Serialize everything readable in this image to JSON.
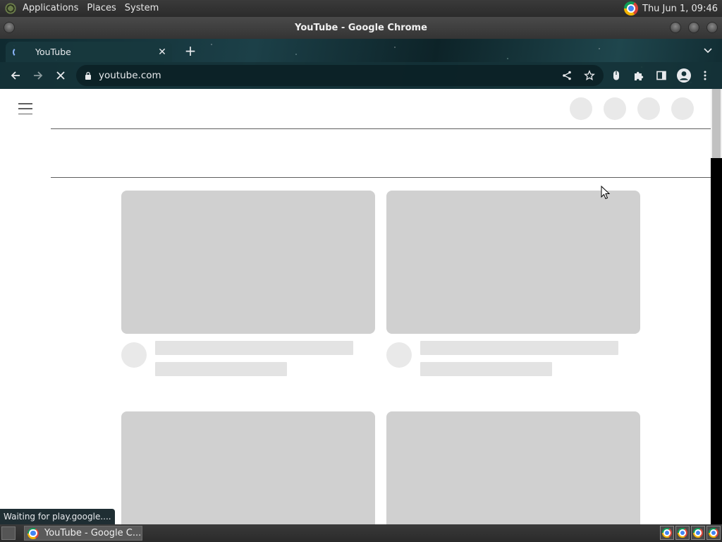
{
  "top_panel": {
    "menu": [
      "Applications",
      "Places",
      "System"
    ],
    "clock": "Thu Jun  1, 09:46"
  },
  "window": {
    "title": "YouTube - Google Chrome"
  },
  "browser": {
    "tab": {
      "title": "YouTube",
      "close_glyph": "✕"
    },
    "new_tab_glyph": "+",
    "url": "youtube.com",
    "status_text": "Waiting for play.google...."
  },
  "taskbar": {
    "task_label": "YouTube - Google C..."
  },
  "icons": {
    "back": "arrow-left-icon",
    "forward": "arrow-right-icon",
    "stop": "close-icon",
    "lock": "lock-icon",
    "share": "share-icon",
    "bookmark": "star-icon",
    "extension_mouse": "mouse-icon",
    "extensions": "puzzle-icon",
    "side_panel": "side-panel-icon",
    "profile": "account-icon",
    "menu": "kebab-icon"
  },
  "colors": {
    "skeleton_thumb": "#d0d0d0",
    "skeleton_line": "#e3e3e3",
    "skeleton_circle": "#e9e9e9",
    "chrome_frame": "#143238"
  }
}
